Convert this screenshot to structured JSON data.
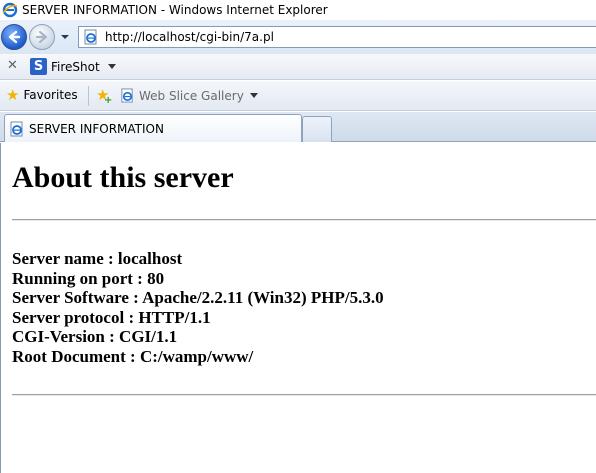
{
  "window": {
    "title": "SERVER INFORMATION - Windows Internet Explorer"
  },
  "address_bar": {
    "url": "http://localhost/cgi-bin/7a.pl"
  },
  "toolbar": {
    "fireshot_label": "FireShot"
  },
  "favorites_bar": {
    "favorites_label": "Favorites",
    "web_slice_label": "Web Slice Gallery"
  },
  "tabs": [
    {
      "label": "SERVER INFORMATION"
    }
  ],
  "page": {
    "heading": "About this server",
    "info_lines": [
      "Server name : localhost",
      "Running on port : 80",
      "Server Software : Apache/2.2.11 (Win32) PHP/5.3.0",
      "Server protocol : HTTP/1.1",
      "CGI-Version : CGI/1.1",
      "Root Document : C:/wamp/www/"
    ]
  },
  "colors": {
    "ie_blue": "#1f5cc9",
    "favorites_star": "#f1b400",
    "chrome_bg": "#dbe6f4"
  },
  "icons": [
    "ie-logo-icon",
    "back-arrow-icon",
    "forward-arrow-icon",
    "page-icon",
    "close-icon",
    "fireshot-icon",
    "star-icon",
    "add-favorite-icon",
    "web-slice-icon"
  ]
}
